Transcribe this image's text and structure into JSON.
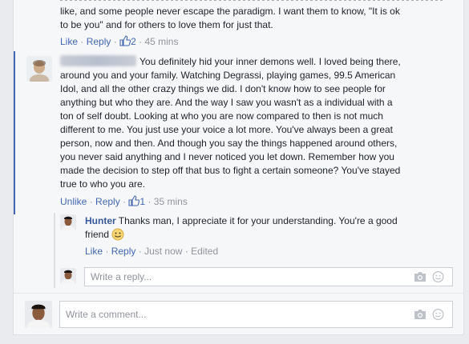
{
  "top_comment": {
    "lines": [
      "like, and some people never escape the paradigm. I want them to know, \"It is ok",
      "to be you\" and for others to love them for just that."
    ],
    "actions": {
      "like": "Like",
      "reply": "Reply",
      "likes": "2",
      "time": "45 mins"
    }
  },
  "comment2": {
    "lines": [
      "You definitely hid your inner demons well. I loved being there,",
      "around you and your family. Watching Degrassi, playing games, 99.5 American",
      "Idol, and all the other crazy things we did. I don't know how to see people for",
      "anything but who they are. And the way I saw you wasn't as a individual with a",
      "ton of self doubt. Looking at who you are now compared to then is not much",
      "different to me. You just use your voice a lot more. You've always been a great",
      "person, now and then. And though you say the things happened around others,",
      "you never said anything and I never noticed you let down. Remember how you",
      "made the decision to step off that bus to fight a certain someone? You've stayed",
      "true to who you are."
    ],
    "actions": {
      "unlike": "Unlike",
      "reply": "Reply",
      "likes": "1",
      "time": "35 mins"
    }
  },
  "reply": {
    "author": "Hunter",
    "line1": "Thanks man, I appreciate it for your understanding. You're a good",
    "line2": "friend",
    "actions": {
      "like": "Like",
      "reply": "Reply",
      "time": "Just now",
      "edited": "Edited"
    }
  },
  "reply_box": {
    "placeholder": "Write a reply..."
  },
  "comment_box": {
    "placeholder": "Write a comment..."
  }
}
